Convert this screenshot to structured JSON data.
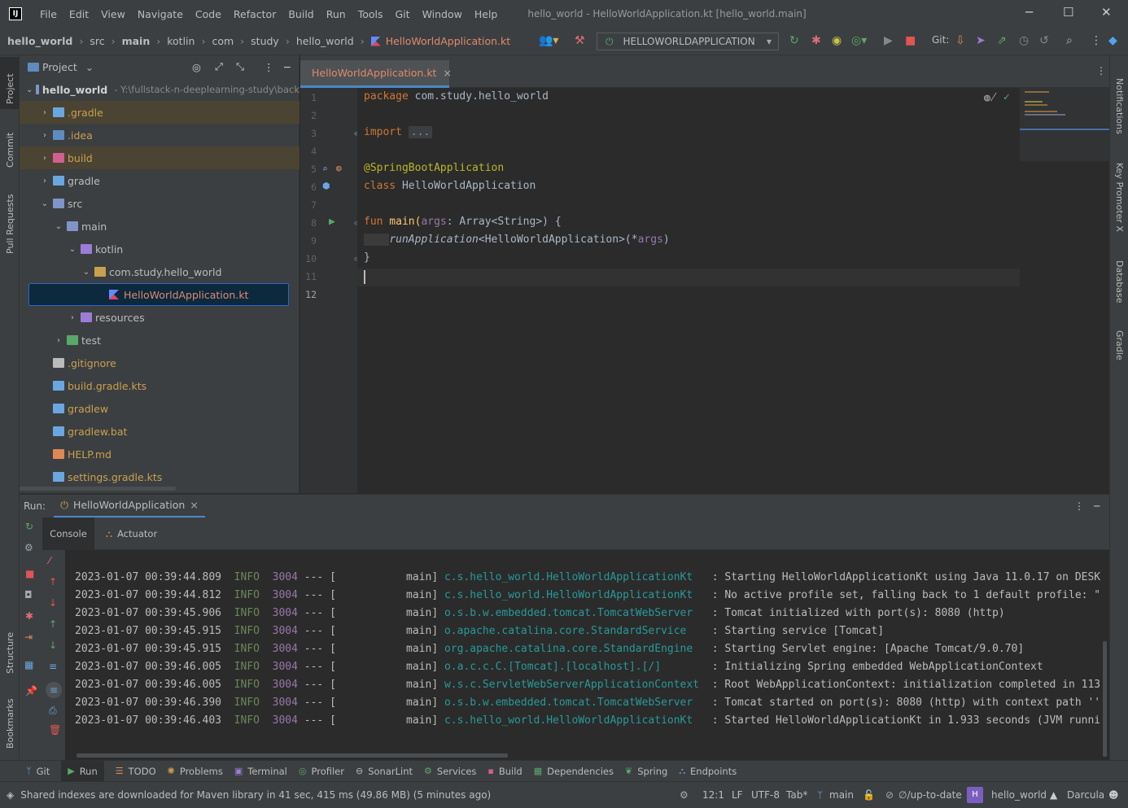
{
  "title_bar": {
    "menus": [
      "File",
      "Edit",
      "View",
      "Navigate",
      "Code",
      "Refactor",
      "Build",
      "Run",
      "Tools",
      "Git",
      "Window",
      "Help"
    ],
    "window_title": "hello_world - HelloWorldApplication.kt [hello_world.main]"
  },
  "breadcrumbs": [
    "hello_world",
    "src",
    "main",
    "kotlin",
    "com",
    "study",
    "hello_world",
    "HelloWorldApplication.kt"
  ],
  "toolbar": {
    "run_config": "HELLOWORLDAPPLICATION",
    "git_label": "Git:"
  },
  "left_strip": [
    "Project",
    "Commit",
    "Pull Requests",
    "Structure",
    "Bookmarks"
  ],
  "right_strip": [
    "Notifications",
    "Key Promoter X",
    "Database",
    "Gradle"
  ],
  "project_panel": {
    "title": "Project",
    "root_name": "hello_world",
    "root_path": "- Y:\\fullstack-n-deeplearning-study\\back",
    "items": [
      {
        "label": ".gradle",
        "depth": 1,
        "chevron": "›",
        "highlight": true,
        "color": "#c9a04e"
      },
      {
        "label": ".idea",
        "depth": 1,
        "chevron": "›",
        "highlight": false,
        "color": "#c9a04e"
      },
      {
        "label": "build",
        "depth": 1,
        "chevron": "›",
        "highlight": true,
        "color": "#c9a04e"
      },
      {
        "label": "gradle",
        "depth": 1,
        "chevron": "›",
        "highlight": false,
        "color": "#bbbbbb"
      },
      {
        "label": "src",
        "depth": 1,
        "chevron": "⌄",
        "highlight": false,
        "color": "#bbbbbb"
      },
      {
        "label": "main",
        "depth": 2,
        "chevron": "⌄",
        "highlight": false,
        "color": "#bbbbbb"
      },
      {
        "label": "kotlin",
        "depth": 3,
        "chevron": "⌄",
        "highlight": false,
        "color": "#bbbbbb"
      },
      {
        "label": "com.study.hello_world",
        "depth": 4,
        "chevron": "⌄",
        "highlight": false,
        "color": "#bbbbbb"
      },
      {
        "label": "HelloWorldApplication.kt",
        "depth": 5,
        "chevron": "",
        "selected": true,
        "color": "#e0896d"
      },
      {
        "label": "resources",
        "depth": 3,
        "chevron": "›",
        "highlight": false,
        "color": "#bbbbbb"
      },
      {
        "label": "test",
        "depth": 2,
        "chevron": "›",
        "highlight": false,
        "color": "#bbbbbb"
      },
      {
        "label": ".gitignore",
        "depth": 1,
        "chevron": "",
        "highlight": false,
        "color": "#c9a04e"
      },
      {
        "label": "build.gradle.kts",
        "depth": 1,
        "chevron": "",
        "highlight": false,
        "color": "#c9a04e"
      },
      {
        "label": "gradlew",
        "depth": 1,
        "chevron": "",
        "highlight": false,
        "color": "#c9a04e"
      },
      {
        "label": "gradlew.bat",
        "depth": 1,
        "chevron": "",
        "highlight": false,
        "color": "#c9a04e"
      },
      {
        "label": "HELP.md",
        "depth": 1,
        "chevron": "",
        "highlight": false,
        "color": "#c9a04e"
      },
      {
        "label": "settings.gradle.kts",
        "depth": 1,
        "chevron": "",
        "highlight": false,
        "color": "#c9a04e"
      }
    ]
  },
  "editor": {
    "tab": "HelloWorldApplication.kt",
    "line_numbers": [
      "1",
      "2",
      "3",
      "4",
      "5",
      "6",
      "7",
      "8",
      "9",
      "10",
      "11",
      "12"
    ],
    "code": {
      "l1_kw": "package",
      "l1_rest": " com.study.hello_world",
      "l3_kw": "import",
      "l3_fold": "...",
      "l6_ann": "@SpringBootApplication",
      "l7_kw": "class",
      "l7_rest": " HelloWorldApplication",
      "l9_kw": "fun",
      "l9_name": " main(",
      "l9_param": "args",
      "l9_rest": ": Array<String>) {",
      "l10_fn": "runApplication",
      "l10_mid": "<HelloWorldApplication>(*",
      "l10_param": "args",
      "l10_end": ")",
      "l11": "}"
    }
  },
  "run_panel": {
    "label": "Run:",
    "tab": "HelloWorldApplication",
    "subtabs": [
      "Console",
      "Actuator"
    ],
    "log": [
      {
        "ts": "2023-01-07 00:39:44.809",
        "lvl": "INFO",
        "pid": "3004",
        "sep": " --- [           main] ",
        "logger": "c.s.hello_world.HelloWorldApplicationKt  ",
        "msg": " : Starting HelloWorldApplicationKt using Java 11.0.17 on DESK"
      },
      {
        "ts": "2023-01-07 00:39:44.812",
        "lvl": "INFO",
        "pid": "3004",
        "sep": " --- [           main] ",
        "logger": "c.s.hello_world.HelloWorldApplicationKt  ",
        "msg": " : No active profile set, falling back to 1 default profile: \""
      },
      {
        "ts": "2023-01-07 00:39:45.906",
        "lvl": "INFO",
        "pid": "3004",
        "sep": " --- [           main] ",
        "logger": "o.s.b.w.embedded.tomcat.TomcatWebServer  ",
        "msg": " : Tomcat initialized with port(s): 8080 (http)"
      },
      {
        "ts": "2023-01-07 00:39:45.915",
        "lvl": "INFO",
        "pid": "3004",
        "sep": " --- [           main] ",
        "logger": "o.apache.catalina.core.StandardService   ",
        "msg": " : Starting service [Tomcat]"
      },
      {
        "ts": "2023-01-07 00:39:45.915",
        "lvl": "INFO",
        "pid": "3004",
        "sep": " --- [           main] ",
        "logger": "org.apache.catalina.core.StandardEngine  ",
        "msg": " : Starting Servlet engine: [Apache Tomcat/9.0.70]"
      },
      {
        "ts": "2023-01-07 00:39:46.005",
        "lvl": "INFO",
        "pid": "3004",
        "sep": " --- [           main] ",
        "logger": "o.a.c.c.C.[Tomcat].[localhost].[/]       ",
        "msg": " : Initializing Spring embedded WebApplicationContext"
      },
      {
        "ts": "2023-01-07 00:39:46.005",
        "lvl": "INFO",
        "pid": "3004",
        "sep": " --- [           main] ",
        "logger": "w.s.c.ServletWebServerApplicationContext ",
        "msg": " : Root WebApplicationContext: initialization completed in 113"
      },
      {
        "ts": "2023-01-07 00:39:46.390",
        "lvl": "INFO",
        "pid": "3004",
        "sep": " --- [           main] ",
        "logger": "o.s.b.w.embedded.tomcat.TomcatWebServer  ",
        "msg": " : Tomcat started on port(s): 8080 (http) with context path ''"
      },
      {
        "ts": "2023-01-07 00:39:46.403",
        "lvl": "INFO",
        "pid": "3004",
        "sep": " --- [           main] ",
        "logger": "c.s.hello_world.HelloWorldApplicationKt  ",
        "msg": " : Started HelloWorldApplicationKt in 1.933 seconds (JVM runni"
      }
    ]
  },
  "bottom_tools": [
    "Git",
    "Run",
    "TODO",
    "Problems",
    "Terminal",
    "Profiler",
    "SonarLint",
    "Services",
    "Build",
    "Dependencies",
    "Spring",
    "Endpoints"
  ],
  "status_bar": {
    "message": "Shared indexes are downloaded for Maven library in 41 sec, 415 ms (49.86 MB) (5 minutes ago)",
    "position": "12:1",
    "line_sep": "LF",
    "encoding": "UTF-8",
    "indent": "Tab*",
    "branch": "main",
    "vcs_state": "∅/up-to-date",
    "project_badge": "H",
    "project": "hello_world",
    "theme": "Darcula"
  }
}
